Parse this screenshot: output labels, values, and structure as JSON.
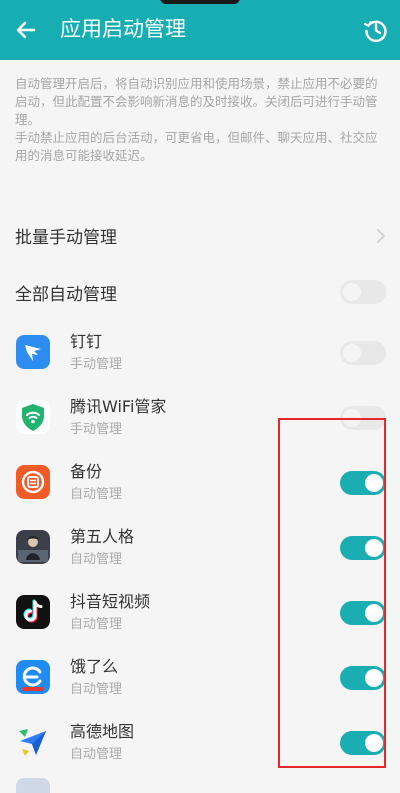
{
  "header": {
    "title": "应用启动管理"
  },
  "description": {
    "p1": "自动管理开启后，将自动识别应用和使用场景，禁止应用不必要的启动，但此配置不会影响新消息的及时接收。关闭后可进行手动管理。",
    "p2": "手动禁止应用的后台活动，可更省电，但邮件、聊天应用、社交应用的消息可能接收延迟。"
  },
  "batch_manual": {
    "label": "批量手动管理"
  },
  "all_auto": {
    "label": "全部自动管理",
    "on": false
  },
  "apps": [
    {
      "name": "钉钉",
      "mode": "手动管理",
      "on": false,
      "icon": "dingtalk-icon",
      "color": "#2c8cf0"
    },
    {
      "name": "腾讯WiFi管家",
      "mode": "手动管理",
      "on": false,
      "icon": "wifi-shield-icon",
      "color": "#21b36f"
    },
    {
      "name": "备份",
      "mode": "自动管理",
      "on": true,
      "icon": "backup-icon",
      "color": "#f25a26"
    },
    {
      "name": "第五人格",
      "mode": "自动管理",
      "on": true,
      "icon": "identity-v-icon",
      "color": "#3a3f4a"
    },
    {
      "name": "抖音短视频",
      "mode": "自动管理",
      "on": true,
      "icon": "tiktok-icon",
      "color": "#111111"
    },
    {
      "name": "饿了么",
      "mode": "自动管理",
      "on": true,
      "icon": "eleme-icon",
      "color": "#1e8cf0"
    },
    {
      "name": "高德地图",
      "mode": "自动管理",
      "on": true,
      "icon": "amap-icon",
      "color": "#2d7df6"
    }
  ]
}
